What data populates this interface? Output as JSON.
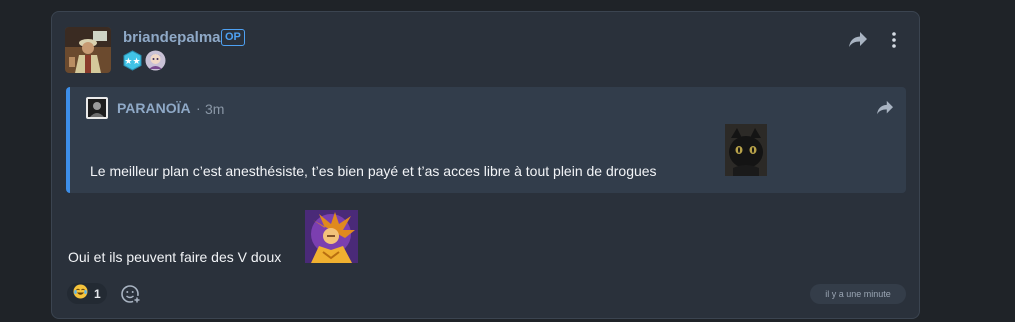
{
  "post": {
    "author": "briandepalma",
    "op_label": "OP",
    "badges": [
      "hexagon-stars-badge-icon",
      "anime-character-badge-icon"
    ],
    "text": "Oui et ils peuvent faire des V doux",
    "reaction": {
      "emoji": "laughing-tears-emoji-icon",
      "count": "1"
    },
    "timestamp": "il y a une minute"
  },
  "quote": {
    "author": "PARANOÏA",
    "separator": "·",
    "time": "3m",
    "text": "Le meilleur plan c’est anesthésiste, t’es bien payé et t’as acces libre à tout plein de drogues"
  },
  "colors": {
    "background": "#1f2328",
    "card": "#2a313b",
    "quote_bg": "#323d4b",
    "quote_accent": "#3d8ee8",
    "username": "#8fa9c7",
    "op_badge": "#4ea1f3"
  }
}
